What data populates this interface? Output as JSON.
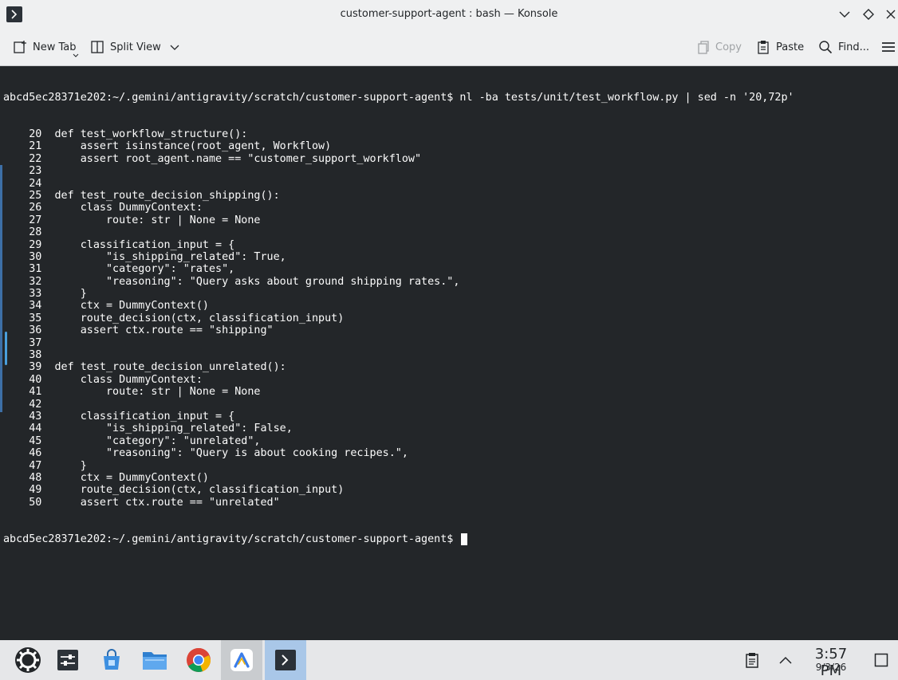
{
  "window": {
    "title": "customer-support-agent : bash — Konsole"
  },
  "toolbar": {
    "new_tab_label": "New Tab",
    "split_view_label": "Split View",
    "copy_label": "Copy",
    "paste_label": "Paste",
    "find_label": "Find..."
  },
  "terminal": {
    "prompt_command": "abcd5ec28371e202:~/.gemini/antigravity/scratch/customer-support-agent$ nl -ba tests/unit/test_workflow.py | sed -n '20,72p'",
    "lines": [
      "    20  def test_workflow_structure():",
      "    21      assert isinstance(root_agent, Workflow)",
      "    22      assert root_agent.name == \"customer_support_workflow\"",
      "    23",
      "    24",
      "    25  def test_route_decision_shipping():",
      "    26      class DummyContext:",
      "    27          route: str | None = None",
      "    28",
      "    29      classification_input = {",
      "    30          \"is_shipping_related\": True,",
      "    31          \"category\": \"rates\",",
      "    32          \"reasoning\": \"Query asks about ground shipping rates.\",",
      "    33      }",
      "    34      ctx = DummyContext()",
      "    35      route_decision(ctx, classification_input)",
      "    36      assert ctx.route == \"shipping\"",
      "    37",
      "    38",
      "    39  def test_route_decision_unrelated():",
      "    40      class DummyContext:",
      "    41          route: str | None = None",
      "    42",
      "    43      classification_input = {",
      "    44          \"is_shipping_related\": False,",
      "    45          \"category\": \"unrelated\",",
      "    46          \"reasoning\": \"Query is about cooking recipes.\",",
      "    47      }",
      "    48      ctx = DummyContext()",
      "    49      route_decision(ctx, classification_input)",
      "    50      assert ctx.route == \"unrelated\""
    ],
    "final_prompt": "abcd5ec28371e202:~/.gemini/antigravity/scratch/customer-support-agent$ "
  },
  "taskbar": {
    "items": [
      "application-launcher-icon",
      "system-settings-icon",
      "discover-store-icon",
      "file-manager-icon",
      "chrome-icon",
      "antigravity-icon",
      "konsole-icon"
    ],
    "clock_time": "3:57 PM",
    "clock_date": "9/3/26"
  }
}
